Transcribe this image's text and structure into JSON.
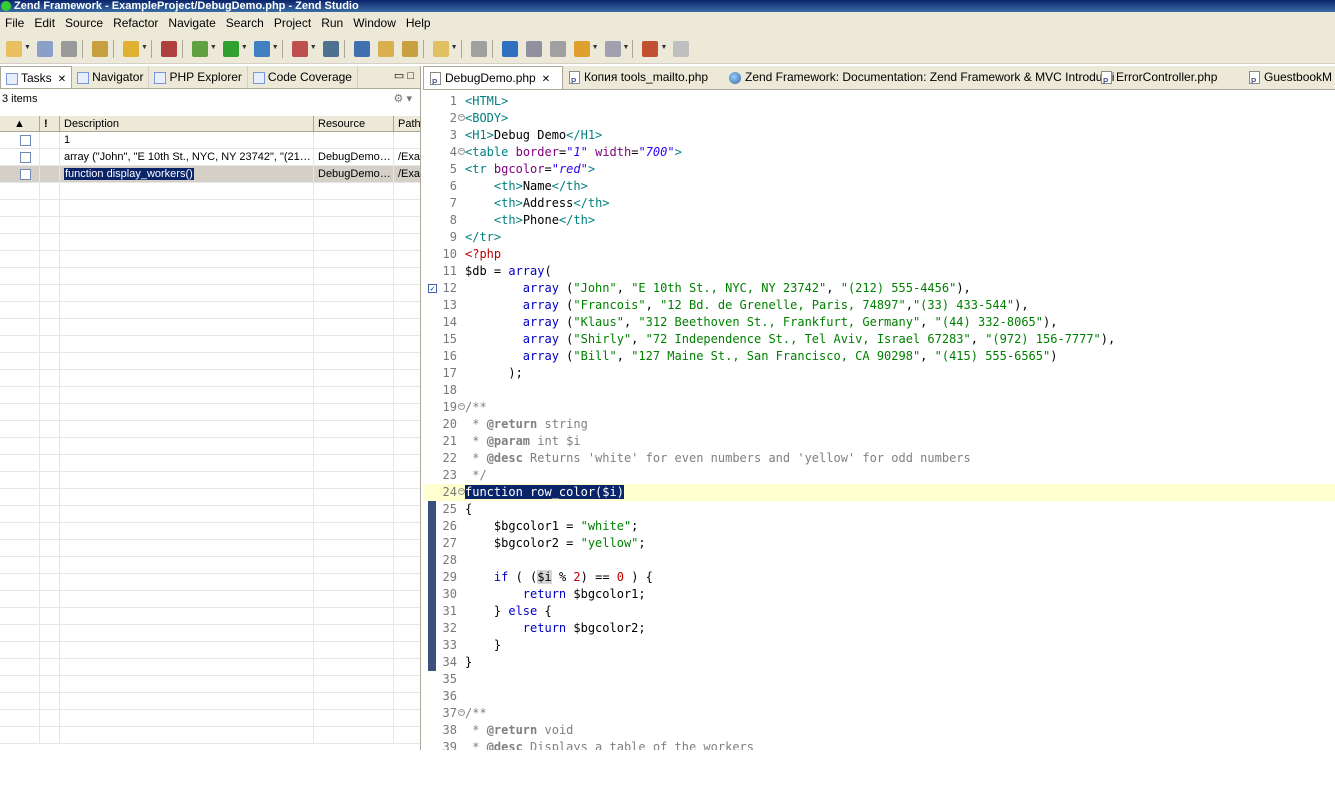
{
  "window": {
    "title": "Zend Framework - ExampleProject/DebugDemo.php - Zend Studio"
  },
  "menu": [
    "File",
    "Edit",
    "Source",
    "Refactor",
    "Navigate",
    "Search",
    "Project",
    "Run",
    "Window",
    "Help"
  ],
  "toolbar_icons": [
    "new-icon",
    "save-icon",
    "print-icon",
    "new-php-icon",
    "open-type-icon",
    "debug-config-icon",
    "debug-icon",
    "run-icon",
    "profile-icon",
    "external-tools-icon",
    "web-icon",
    "browser-icon",
    "open-folder-icon",
    "open-project-icon",
    "search-icon",
    "pencil-icon",
    "globe-icon",
    "prev-edit-icon",
    "last-edit-icon",
    "back-icon",
    "forward-icon",
    "pin-icon",
    "view-icon"
  ],
  "left_panel": {
    "tabs": [
      {
        "label": "Tasks",
        "active": true
      },
      {
        "label": "Navigator"
      },
      {
        "label": "PHP Explorer"
      },
      {
        "label": "Code Coverage"
      }
    ],
    "item_count": "3 items",
    "columns": [
      "!",
      "Description",
      "Resource",
      "Path"
    ],
    "rows": [
      {
        "description": "1",
        "resource": "",
        "path": ""
      },
      {
        "description": "array (\"John\", \"E 10th St., NYC, NY 23742\", \"(21…",
        "resource": "DebugDemo…",
        "path": "/Exa"
      },
      {
        "description": "function display_workers()",
        "resource": "DebugDemo…",
        "path": "/Exa",
        "selected": true
      }
    ]
  },
  "editor_tabs": [
    {
      "label": "DebugDemo.php",
      "active": true,
      "icon": "php-file-icon"
    },
    {
      "label": "Копия tools_mailto.php",
      "icon": "php-file-icon"
    },
    {
      "label": "Zend Framework: Documentation: Zend Framework & MVC Introducti",
      "icon": "globe-icon"
    },
    {
      "label": "ErrorController.php",
      "icon": "php-file-icon"
    },
    {
      "label": "GuestbookM",
      "icon": "php-file-icon"
    }
  ],
  "code_lines": [
    {
      "n": "1",
      "html": "<span class='tg'>&lt;HTML&gt;</span>"
    },
    {
      "n": "2",
      "fold": true,
      "html": "<span class='tg'>&lt;BODY&gt;</span>"
    },
    {
      "n": "3",
      "html": "<span class='tg'>&lt;H1&gt;</span>Debug Demo<span class='tg'>&lt;/H1&gt;</span>"
    },
    {
      "n": "4",
      "fold": true,
      "html": "<span class='tg'>&lt;table</span> <span class='at'>border</span>=<span class='av'>\"1\"</span> <span class='at'>width</span>=<span class='av'>\"700\"</span><span class='tg'>&gt;</span>"
    },
    {
      "n": "5",
      "html": "<span class='tg'>&lt;tr</span> <span class='at'>bgcolor</span>=<span class='av'>\"red\"</span><span class='tg'>&gt;</span>"
    },
    {
      "n": "6",
      "html": "    <span class='tg'>&lt;th&gt;</span>Name<span class='tg'>&lt;/th&gt;</span>"
    },
    {
      "n": "7",
      "html": "    <span class='tg'>&lt;th&gt;</span>Address<span class='tg'>&lt;/th&gt;</span>"
    },
    {
      "n": "8",
      "html": "    <span class='tg'>&lt;th&gt;</span>Phone<span class='tg'>&lt;/th&gt;</span>"
    },
    {
      "n": "9",
      "html": "<span class='tg'>&lt;/tr&gt;</span>"
    },
    {
      "n": "10",
      "html": "<span class='php'>&lt;?php</span>"
    },
    {
      "n": "11",
      "html": "$db = <span class='kw'>array</span>("
    },
    {
      "n": "12",
      "check": true,
      "html": "        <span class='kw'>array</span> (<span class='st'>\"John\"</span>, <span class='st'>\"E 10th St., NYC, NY 23742\"</span>, <span class='st'>\"(212) 555-4456\"</span>),"
    },
    {
      "n": "13",
      "html": "        <span class='kw'>array</span> (<span class='st'>\"Francois\"</span>, <span class='st'>\"12 Bd. de Grenelle, Paris, 74897\"</span>,<span class='st'>\"(33) 433-544\"</span>),"
    },
    {
      "n": "14",
      "html": "        <span class='kw'>array</span> (<span class='st'>\"Klaus\"</span>, <span class='st'>\"312 Beethoven St., Frankfurt, Germany\"</span>, <span class='st'>\"(44) 332-8065\"</span>),"
    },
    {
      "n": "15",
      "html": "        <span class='kw'>array</span> (<span class='st'>\"Shirly\"</span>, <span class='st'>\"72 Independence St., Tel Aviv, Israel 67283\"</span>, <span class='st'>\"(972) 156-7777\"</span>),"
    },
    {
      "n": "16",
      "html": "        <span class='kw'>array</span> (<span class='st'>\"Bill\"</span>, <span class='st'>\"127 Maine St., San Francisco, CA 90298\"</span>, <span class='st'>\"(415) 555-6565\"</span>)"
    },
    {
      "n": "17",
      "html": "      );"
    },
    {
      "n": "18",
      "html": ""
    },
    {
      "n": "19",
      "fold": true,
      "html": "<span class='cm'>/**</span>"
    },
    {
      "n": "20",
      "html": "<span class='cm'> * </span><span class='tk'>@return</span><span class='cm'> string</span>"
    },
    {
      "n": "21",
      "html": "<span class='cm'> * </span><span class='tk'>@param</span><span class='cm'> int $i</span>"
    },
    {
      "n": "22",
      "html": "<span class='cm'> * </span><span class='tk'>@desc</span><span class='cm'> Returns 'white' for even numbers and 'yellow' for odd numbers</span>"
    },
    {
      "n": "23",
      "html": "<span class='cm'> */</span>"
    },
    {
      "n": "24",
      "fold": true,
      "current": true,
      "bar": true,
      "html": "<span class='selh'>function row_color($i)</span>"
    },
    {
      "n": "25",
      "bar": true,
      "html": "{"
    },
    {
      "n": "26",
      "bar": true,
      "html": "    $bgcolor1 = <span class='st'>\"white\"</span>;"
    },
    {
      "n": "27",
      "bar": true,
      "html": "    $bgcolor2 = <span class='st'>\"yellow\"</span>;"
    },
    {
      "n": "28",
      "bar": true,
      "html": ""
    },
    {
      "n": "29",
      "bar": true,
      "html": "    <span class='kw'>if</span> ( (<span class='occ'>$i</span> % <span class='nm'>2</span>) == <span class='nm'>0</span> ) {"
    },
    {
      "n": "30",
      "bar": true,
      "html": "        <span class='kw'>return</span> $bgcolor1;"
    },
    {
      "n": "31",
      "bar": true,
      "html": "    } <span class='kw'>else</span> {"
    },
    {
      "n": "32",
      "bar": true,
      "html": "        <span class='kw'>return</span> $bgcolor2;"
    },
    {
      "n": "33",
      "bar": true,
      "html": "    }"
    },
    {
      "n": "34",
      "bar": true,
      "html": "}"
    },
    {
      "n": "35",
      "html": ""
    },
    {
      "n": "36",
      "html": ""
    },
    {
      "n": "37",
      "fold": true,
      "html": "<span class='cm'>/**</span>"
    },
    {
      "n": "38",
      "html": "<span class='cm'> * </span><span class='tk'>@return</span><span class='cm'> void</span>"
    },
    {
      "n": "39",
      "html": "<span class='cm'> * </span><span class='tk'>@desc</span><span class='cm'> Displays a table of the workers</span>"
    }
  ]
}
